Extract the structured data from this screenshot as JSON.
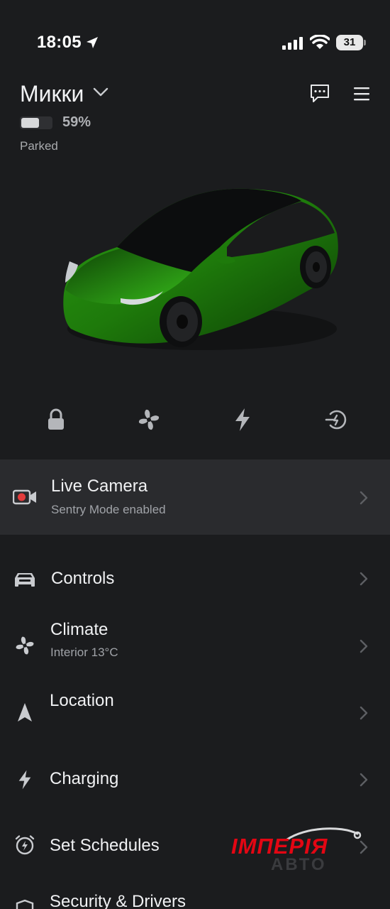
{
  "status_bar": {
    "time": "18:05",
    "battery_level": "31",
    "icons": [
      "location-arrow-icon",
      "cellular-signal-icon",
      "wifi-icon",
      "battery-icon"
    ]
  },
  "vehicle": {
    "name": "Микки",
    "battery_percent": "59%",
    "battery_fraction": 0.59,
    "status": "Parked",
    "paint_color": "#1f7a0c"
  },
  "header_actions": [
    "chat-icon",
    "menu-icon"
  ],
  "quick_actions": [
    "lock-icon",
    "fan-icon",
    "lightning-icon",
    "charge-port-icon"
  ],
  "menu": {
    "live_camera": {
      "title": "Live Camera",
      "subtitle": "Sentry Mode enabled"
    },
    "controls": {
      "title": "Controls"
    },
    "climate": {
      "title": "Climate",
      "subtitle": "Interior 13°C"
    },
    "location": {
      "title": "Location"
    },
    "charging": {
      "title": "Charging"
    },
    "schedules": {
      "title": "Set Schedules"
    },
    "security": {
      "title": "Security & Drivers"
    }
  },
  "watermark": {
    "brand": "ІМПЕРІЯ",
    "sub": "АВТО"
  },
  "colors": {
    "background": "#1b1c1e",
    "highlight_row": "#2a2b2e",
    "record_red": "#e33c3c",
    "watermark_red": "#e30613"
  }
}
